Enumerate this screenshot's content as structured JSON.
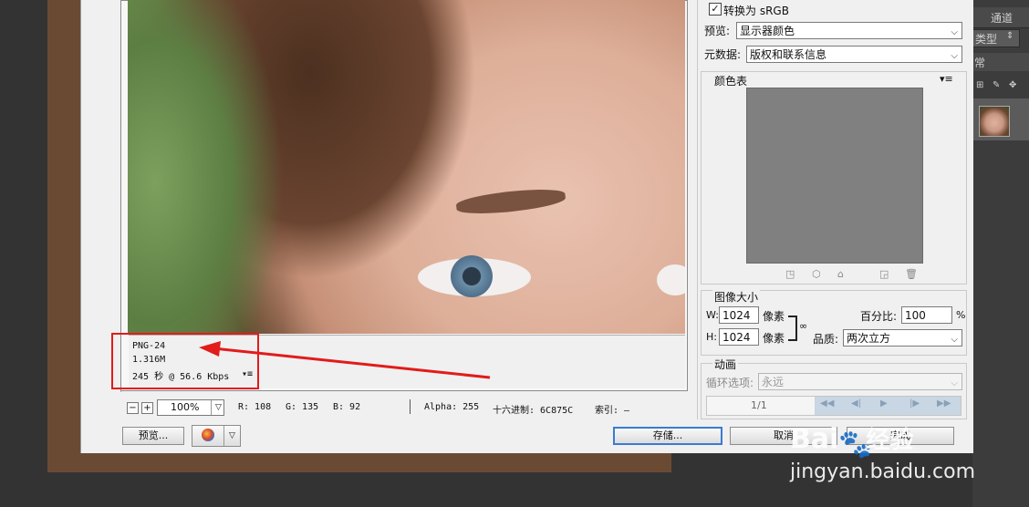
{
  "preview_info": {
    "format": "PNG-24",
    "size": "1.316M",
    "download_time": "245 秒 @ 56.6 Kbps",
    "menu_icon": "▾≡"
  },
  "status_bar": {
    "zoom_value": "100%",
    "r": "R: 108",
    "g": "G: 135",
    "b": "B: 92",
    "alpha": "Alpha: 255",
    "hex": "十六进制: 6C875C",
    "index": "索引: —"
  },
  "bottom_buttons": {
    "preview_label": "预览...",
    "save_label": "存储...",
    "cancel_label": "取消",
    "done_label": "完成"
  },
  "settings": {
    "convert_srgb_label": "转换为 sRGB",
    "convert_srgb_checked": true,
    "preview_label": "预览:",
    "preview_value": "显示器颜色",
    "metadata_label": "元数据:",
    "metadata_value": "版权和联系信息"
  },
  "color_table": {
    "title": "颜色表",
    "menu_icon": "▾≡"
  },
  "image_size": {
    "title": "图像大小",
    "w_label": "W:",
    "w_value": "1024",
    "h_label": "H:",
    "h_value": "1024",
    "unit": "像素",
    "percent_label": "百分比:",
    "percent_value": "100",
    "percent_sign": "%",
    "quality_label": "品质:",
    "quality_value": "两次立方"
  },
  "animation": {
    "title": "动画",
    "loop_label": "循环选项:",
    "loop_value": "永远",
    "frame_counter": "1/1"
  },
  "ps_panel": {
    "tab_channels": "通道",
    "filter_type": "类型",
    "blend_mode": "常"
  },
  "watermark": {
    "logo_text": "Bai",
    "logo_suffix": "经验",
    "url": "jingyan.baidu.com"
  },
  "colors": {
    "highlight": "#e21b1b",
    "dialog_bg": "#f0f0f0",
    "color_table_fill": "#808080"
  }
}
